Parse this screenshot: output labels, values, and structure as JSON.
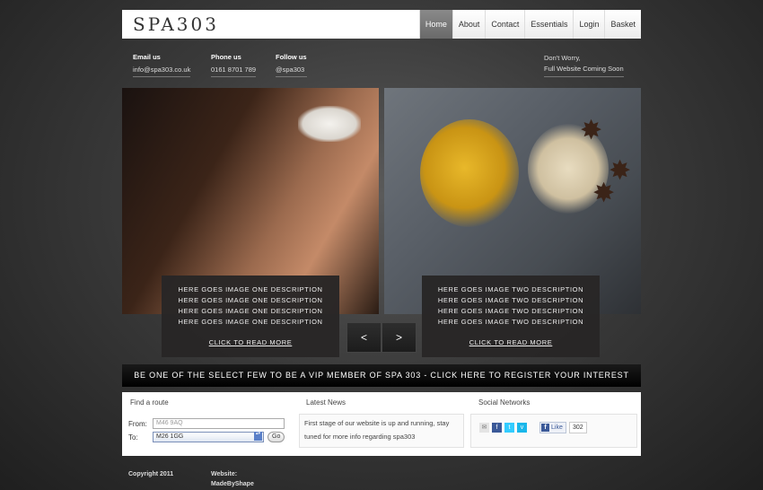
{
  "header": {
    "logo": "SPA303",
    "nav": [
      "Home",
      "About",
      "Contact",
      "Essentials",
      "Login",
      "Basket"
    ],
    "active_nav": "Home"
  },
  "contact": {
    "email_label": "Email us",
    "email_value": "info@spa303.co.uk",
    "phone_label": "Phone us",
    "phone_value": "0161 8701 789",
    "follow_label": "Follow us",
    "follow_value": "@spa303"
  },
  "notice": {
    "line1": "Don't Worry,",
    "line2": "Full Website Coming Soon"
  },
  "slides": [
    {
      "lines": [
        "HERE GOES IMAGE ONE DESCRIPTION",
        "HERE GOES IMAGE ONE DESCRIPTION",
        "HERE GOES IMAGE ONE DESCRIPTION",
        "HERE GOES IMAGE ONE DESCRIPTION"
      ],
      "link": "CLICK TO READ MORE"
    },
    {
      "lines": [
        "HERE GOES IMAGE TWO DESCRIPTION",
        "HERE GOES IMAGE TWO DESCRIPTION",
        "HERE GOES IMAGE TWO DESCRIPTION",
        "HERE GOES IMAGE TWO DESCRIPTION"
      ],
      "link": "CLICK TO READ MORE"
    }
  ],
  "slider": {
    "prev": "<",
    "next": ">"
  },
  "vip_banner": "BE ONE OF THE SELECT FEW TO BE A VIP MEMBER OF SPA 303 - CLICK HERE TO REGISTER YOUR INTEREST NOW",
  "route": {
    "title": "Find a route",
    "from_label": "From:",
    "from_placeholder": "M46 9AQ",
    "to_label": "To:",
    "to_value": "M26 1GG",
    "go_label": "Go"
  },
  "news": {
    "title": "Latest News",
    "text": "First stage of our website is up and running, stay tuned for more info regarding spa303"
  },
  "social": {
    "title": "Social Networks",
    "like_label": "Like",
    "like_count": "302",
    "icons": [
      "email-icon",
      "facebook-icon",
      "twitter-icon",
      "vimeo-icon"
    ],
    "colors": {
      "facebook": "#3b5998",
      "twitter": "#33ccff",
      "vimeo": "#1ab7ea"
    }
  },
  "footer": {
    "copyright": "Copyright 2011",
    "website_label": "Website:",
    "website_value": "MadeByShape"
  }
}
